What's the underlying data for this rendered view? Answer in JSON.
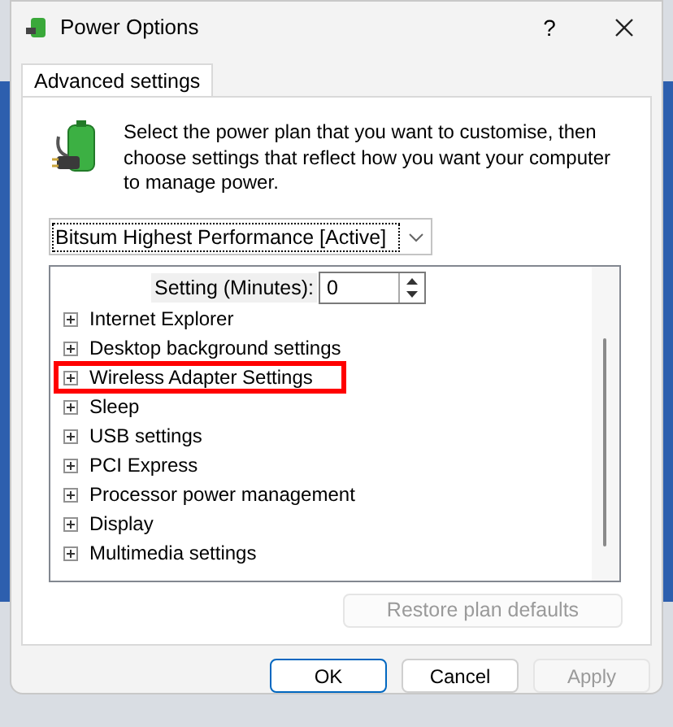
{
  "window": {
    "title": "Power Options",
    "help": "?"
  },
  "tabs": [
    {
      "label": "Advanced settings",
      "selected": true
    }
  ],
  "description": "Select the power plan that you want to customise, then choose settings that reflect how you want your computer to manage power.",
  "plan_dropdown": {
    "value": "Bitsum Highest Performance [Active]"
  },
  "setting": {
    "label": "Setting (Minutes):",
    "value": "0"
  },
  "tree": [
    {
      "label": "Internet Explorer",
      "expanded": false
    },
    {
      "label": "Desktop background settings",
      "expanded": false
    },
    {
      "label": "Wireless Adapter Settings",
      "expanded": false,
      "highlighted": true
    },
    {
      "label": "Sleep",
      "expanded": false
    },
    {
      "label": "USB settings",
      "expanded": false
    },
    {
      "label": "PCI Express",
      "expanded": false
    },
    {
      "label": "Processor power management",
      "expanded": false
    },
    {
      "label": "Display",
      "expanded": false
    },
    {
      "label": "Multimedia settings",
      "expanded": false
    }
  ],
  "restore_button": {
    "label": "Restore plan defaults",
    "disabled": true
  },
  "buttons": [
    {
      "label": "OK",
      "disabled": false,
      "default": true
    },
    {
      "label": "Cancel",
      "disabled": false,
      "default": false
    },
    {
      "label": "Apply",
      "disabled": true,
      "default": false
    }
  ]
}
